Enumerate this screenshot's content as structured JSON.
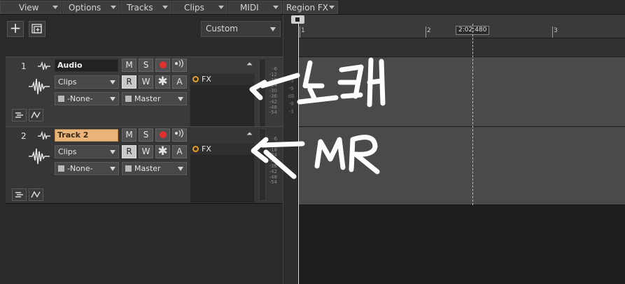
{
  "menubar": {
    "items": [
      {
        "label": "View"
      },
      {
        "label": "Options"
      },
      {
        "label": "Tracks"
      },
      {
        "label": "Clips"
      },
      {
        "label": "MIDI"
      },
      {
        "label": "Region FX"
      }
    ]
  },
  "toolbar": {
    "add_label": "+",
    "view_preset": "Custom"
  },
  "tracks": [
    {
      "number": "1",
      "name": "Audio",
      "name_style": "dark",
      "mute": "M",
      "solo": "S",
      "read": "R",
      "write": "W",
      "archive": "A",
      "clip_mode": "Clips",
      "input": "-None-",
      "output": "Master",
      "fx": "FX",
      "meter_scale": [
        "-6",
        "-12",
        "-18",
        "-24",
        "-30",
        "-36",
        "-42",
        "-48",
        "-54"
      ]
    },
    {
      "number": "2",
      "name": "Track 2",
      "name_style": "orange",
      "mute": "M",
      "solo": "S",
      "read": "R",
      "write": "W",
      "archive": "A",
      "clip_mode": "Clips",
      "input": "-None-",
      "output": "Master",
      "fx": "FX",
      "meter_scale": [
        "-6",
        "-12",
        "-18",
        "-24",
        "-30",
        "-36",
        "-42",
        "-48",
        "-54"
      ]
    }
  ],
  "meter_scale_center": [
    "-3",
    "-9",
    "dB",
    "-9",
    "-3"
  ],
  "timeline": {
    "markers": [
      "1",
      "2",
      "3"
    ],
    "now_time": "2:02:480"
  },
  "colors": {
    "record": "#e0302e",
    "fx_power": "#e79f2a",
    "track2_name": "#e8b47a"
  }
}
